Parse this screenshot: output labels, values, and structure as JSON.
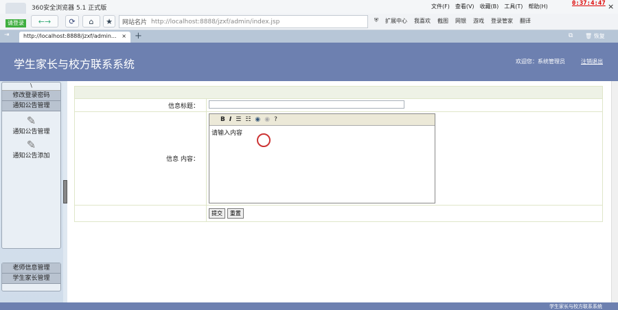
{
  "browser": {
    "title": "360安全浏览器 5.1 正式版",
    "login": "请登录",
    "site_label": "网站名片",
    "url": "http://localhost:8888/jzxf/admin/index.jsp",
    "menu": [
      "文件(F)",
      "查看(V)",
      "收藏(B)",
      "工具(T)",
      "帮助(H)"
    ],
    "clock": "0:37:4:47",
    "toolbar_items": [
      "扩展中心",
      "我喜欢",
      "截图",
      "网银",
      "游戏",
      "登录管家",
      "翻译"
    ],
    "tab": "http://localhost:8888/jzxf/admin...",
    "restore": "恢复"
  },
  "header": {
    "title": "学生家长与校方联系系统",
    "welcome": "欢迎您：系统管理员",
    "logout": "注销退出"
  },
  "sidebar": {
    "top_marker": "\\",
    "change_password": "修改登录密码",
    "notice_mgmt": "通知公告管理",
    "links": [
      "通知公告管理",
      "通知公告添加"
    ],
    "teacher_mgmt": "老师信息管理",
    "parent_mgmt": "学生家长管理"
  },
  "form": {
    "title_label": "信息标题：",
    "title_value": "",
    "content_label": "信息 内容：",
    "content_value": "请输入内容",
    "submit": "提交",
    "reset": "重置"
  },
  "footer": {
    "text": "学生家长与校方联系系统"
  }
}
